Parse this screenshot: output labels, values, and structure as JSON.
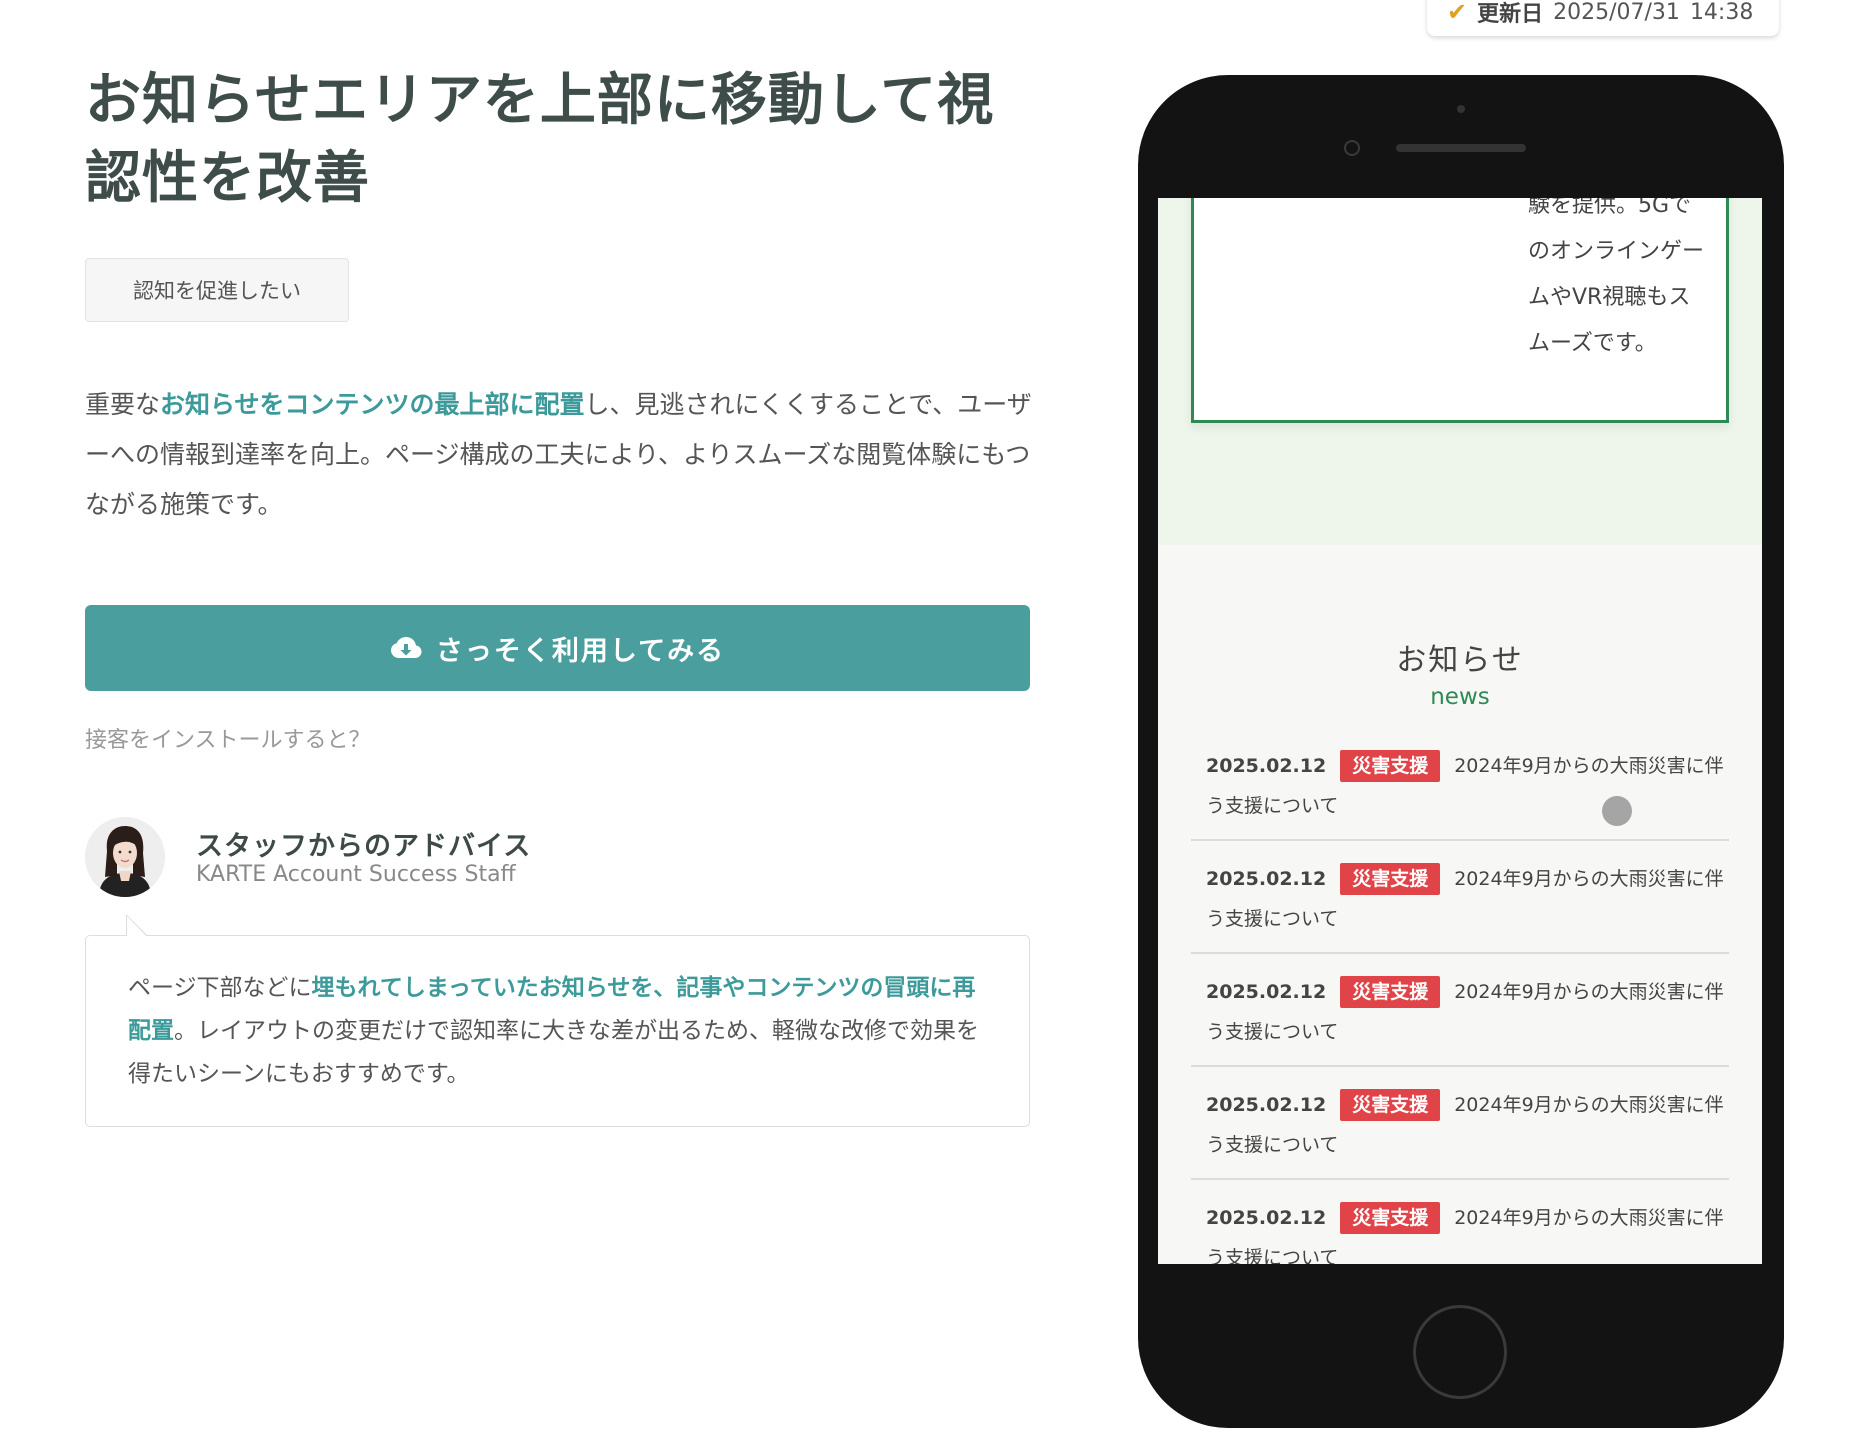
{
  "updated": {
    "label": "更新日",
    "date": "2025/07/31",
    "time": "14:38"
  },
  "article": {
    "title": "お知らせエリアを上部に移動して視認性を改善",
    "tag": "認知を促進したい",
    "desc": {
      "before": "重要な",
      "highlight": "お知らせをコンテンツの最上部に配置",
      "after": "し、見逃されにくくすることで、ユーザーへの情報到達率を向上。ページ構成の工夫により、よりスムーズな閲覧体験にもつながる施策です。"
    },
    "cta_label": "さっそく利用してみる",
    "install_link": "接客をインストールすると？"
  },
  "advice": {
    "name": "スタッフからのアドバイス",
    "role": "KARTE Account Success Staff",
    "before": "ページ下部などに",
    "highlight": "埋もれてしまっていたお知らせを、記事やコンテンツの冒頭に再配置",
    "after": "。レイアウトの変更だけで認知率に大きな差が出るため、軽微な改修で効果を得たいシーンにもおすすめです。"
  },
  "phone": {
    "card_text": "験を提供。5GでのオンラインゲームやVR視聴もスムーズです。",
    "news_title": "お知らせ",
    "news_sub": "news",
    "news_items": [
      {
        "date": "2025.02.12",
        "badge": "災害支援",
        "text": "2024年9月からの大雨災害に伴う支援について"
      },
      {
        "date": "2025.02.12",
        "badge": "災害支援",
        "text": "2024年9月からの大雨災害に伴う支援について"
      },
      {
        "date": "2025.02.12",
        "badge": "災害支援",
        "text": "2024年9月からの大雨災害に伴う支援について"
      },
      {
        "date": "2025.02.12",
        "badge": "災害支援",
        "text": "2024年9月からの大雨災害に伴う支援について"
      },
      {
        "date": "2025.02.12",
        "badge": "災害支援",
        "text": "2024年9月からの大雨災害に伴う支援について"
      }
    ]
  },
  "colors": {
    "accent": "#4b9e9e",
    "highlight_text": "#3d9a9a",
    "badge_red": "#e04448",
    "news_green": "#2e8a54"
  },
  "icons": {
    "updated": "check-icon",
    "cta": "cloud-download-icon"
  }
}
